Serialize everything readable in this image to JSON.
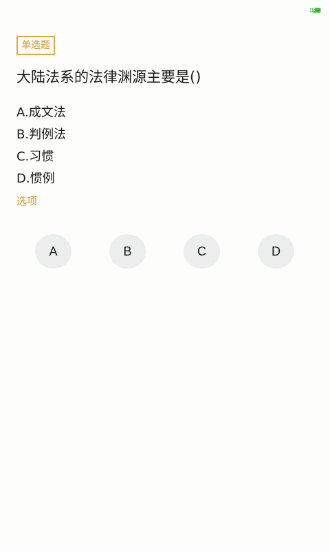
{
  "status_bar": {
    "battery_icon": "battery-charging-icon",
    "battery_color": "#3cb83c"
  },
  "question": {
    "type_label": "单选题",
    "title": "大陆法系的法律渊源主要是()",
    "options": [
      {
        "label": "A.成文法"
      },
      {
        "label": "B.判例法"
      },
      {
        "label": "C.习惯"
      },
      {
        "label": "D.惯例"
      }
    ]
  },
  "answer_section": {
    "label": "选项",
    "buttons": [
      {
        "label": "A"
      },
      {
        "label": "B"
      },
      {
        "label": "C"
      },
      {
        "label": "D"
      }
    ]
  },
  "colors": {
    "accent": "#d6982e",
    "badge_border": "#e1a740",
    "button_bg": "#eceded",
    "text": "#1a1a1a"
  }
}
